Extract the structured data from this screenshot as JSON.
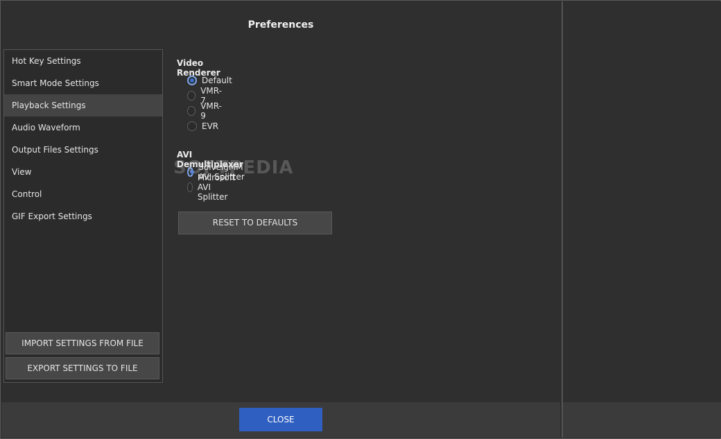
{
  "dialog": {
    "title": "Preferences"
  },
  "sidebar": {
    "items": [
      {
        "label": "Hot Key Settings"
      },
      {
        "label": "Smart Mode Settings"
      },
      {
        "label": "Playback Settings",
        "active": true
      },
      {
        "label": "Audio Waveform"
      },
      {
        "label": "Output Files Settings"
      },
      {
        "label": "View"
      },
      {
        "label": "Control"
      },
      {
        "label": "GIF Export Settings"
      }
    ],
    "import_label": "IMPORT SETTINGS FROM FILE",
    "export_label": "EXPORT SETTINGS TO FILE"
  },
  "video_renderer": {
    "title": "Video Renderer",
    "options": [
      "Default",
      "VMR-7",
      "VMR-9",
      "EVR"
    ],
    "selected": "Default"
  },
  "avi_demux": {
    "title": "AVI Demultiplexer",
    "options": [
      "SolveigMM AVI Splitter",
      "Microsoft AVI Splitter"
    ],
    "selected": "SolveigMM AVI Splitter"
  },
  "reset_label": "RESET TO DEFAULTS",
  "footer": {
    "close_label": "CLOSE"
  },
  "watermark": "SOFTPEDIA",
  "colors": {
    "accent": "#2f5fc0",
    "background": "#2f2f2f",
    "active_item": "#444444"
  }
}
